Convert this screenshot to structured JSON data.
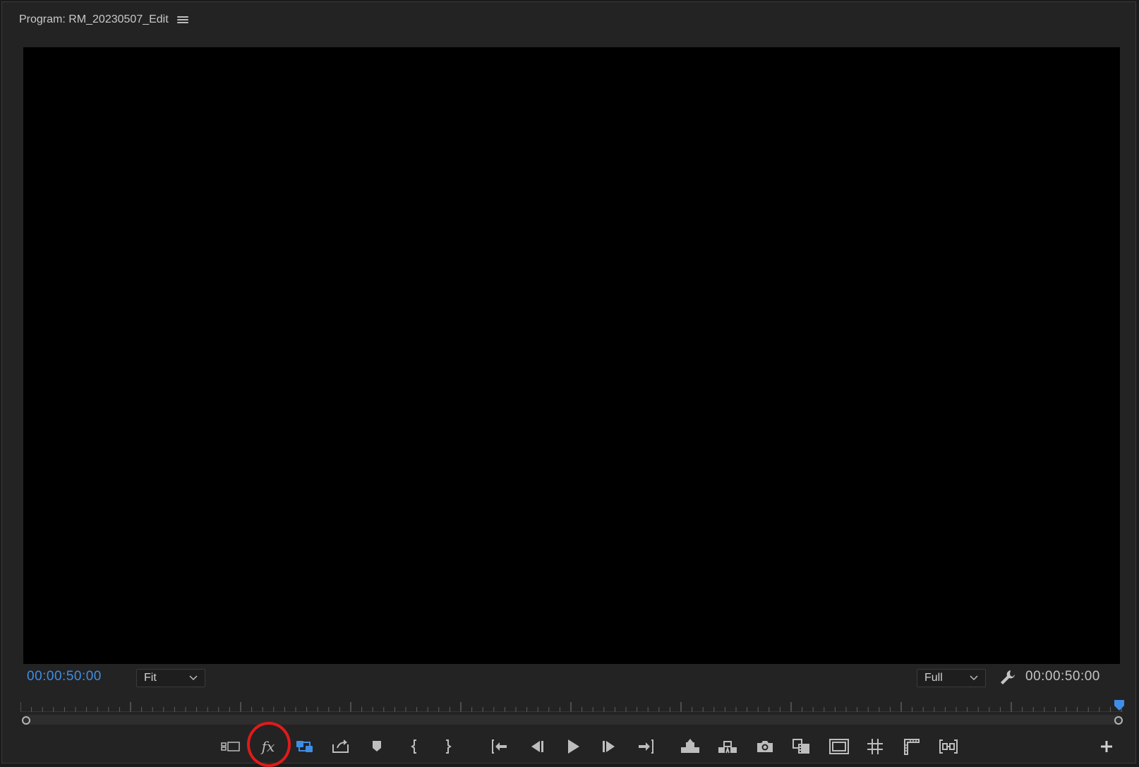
{
  "panel": {
    "title": "Program: RM_20230507_Edit",
    "menu_icon": "hamburger-menu-icon"
  },
  "controls": {
    "current_timecode": "00:00:50:00",
    "duration_timecode": "00:00:50:00",
    "zoom_select": {
      "selected": "Fit"
    },
    "resolution_select": {
      "selected": "Full"
    },
    "settings_icon": "wrench-icon"
  },
  "transport": {
    "buttons": [
      {
        "name": "comparison-view",
        "icon": "comparison-view-icon"
      },
      {
        "name": "fx-toggle",
        "icon": "fx-icon",
        "label": "fx"
      },
      {
        "name": "loop-playback",
        "icon": "loop-icon",
        "active": true
      },
      {
        "name": "export-frame",
        "icon": "export-icon"
      },
      {
        "name": "add-marker",
        "icon": "marker-icon"
      },
      {
        "name": "mark-in",
        "icon": "mark-in-icon"
      },
      {
        "name": "mark-out",
        "icon": "mark-out-icon"
      },
      {
        "name": "go-to-in",
        "icon": "go-to-in-icon"
      },
      {
        "name": "step-back",
        "icon": "step-back-icon"
      },
      {
        "name": "play",
        "icon": "play-icon"
      },
      {
        "name": "step-forward",
        "icon": "step-forward-icon"
      },
      {
        "name": "go-to-out",
        "icon": "go-to-out-icon"
      },
      {
        "name": "lift",
        "icon": "lift-icon"
      },
      {
        "name": "extract",
        "icon": "extract-icon"
      },
      {
        "name": "export-frame-camera",
        "icon": "camera-icon"
      },
      {
        "name": "insert-clip",
        "icon": "insert-clip-icon"
      },
      {
        "name": "safe-margins",
        "icon": "safe-margins-icon"
      },
      {
        "name": "grid",
        "icon": "grid-icon"
      },
      {
        "name": "guides",
        "icon": "ruler-icon"
      },
      {
        "name": "snap-guides",
        "icon": "snap-icon"
      },
      {
        "name": "button-editor",
        "icon": "plus-icon"
      }
    ]
  },
  "colors": {
    "accent": "#3f8ee6",
    "annotation": "#e01a1a"
  }
}
